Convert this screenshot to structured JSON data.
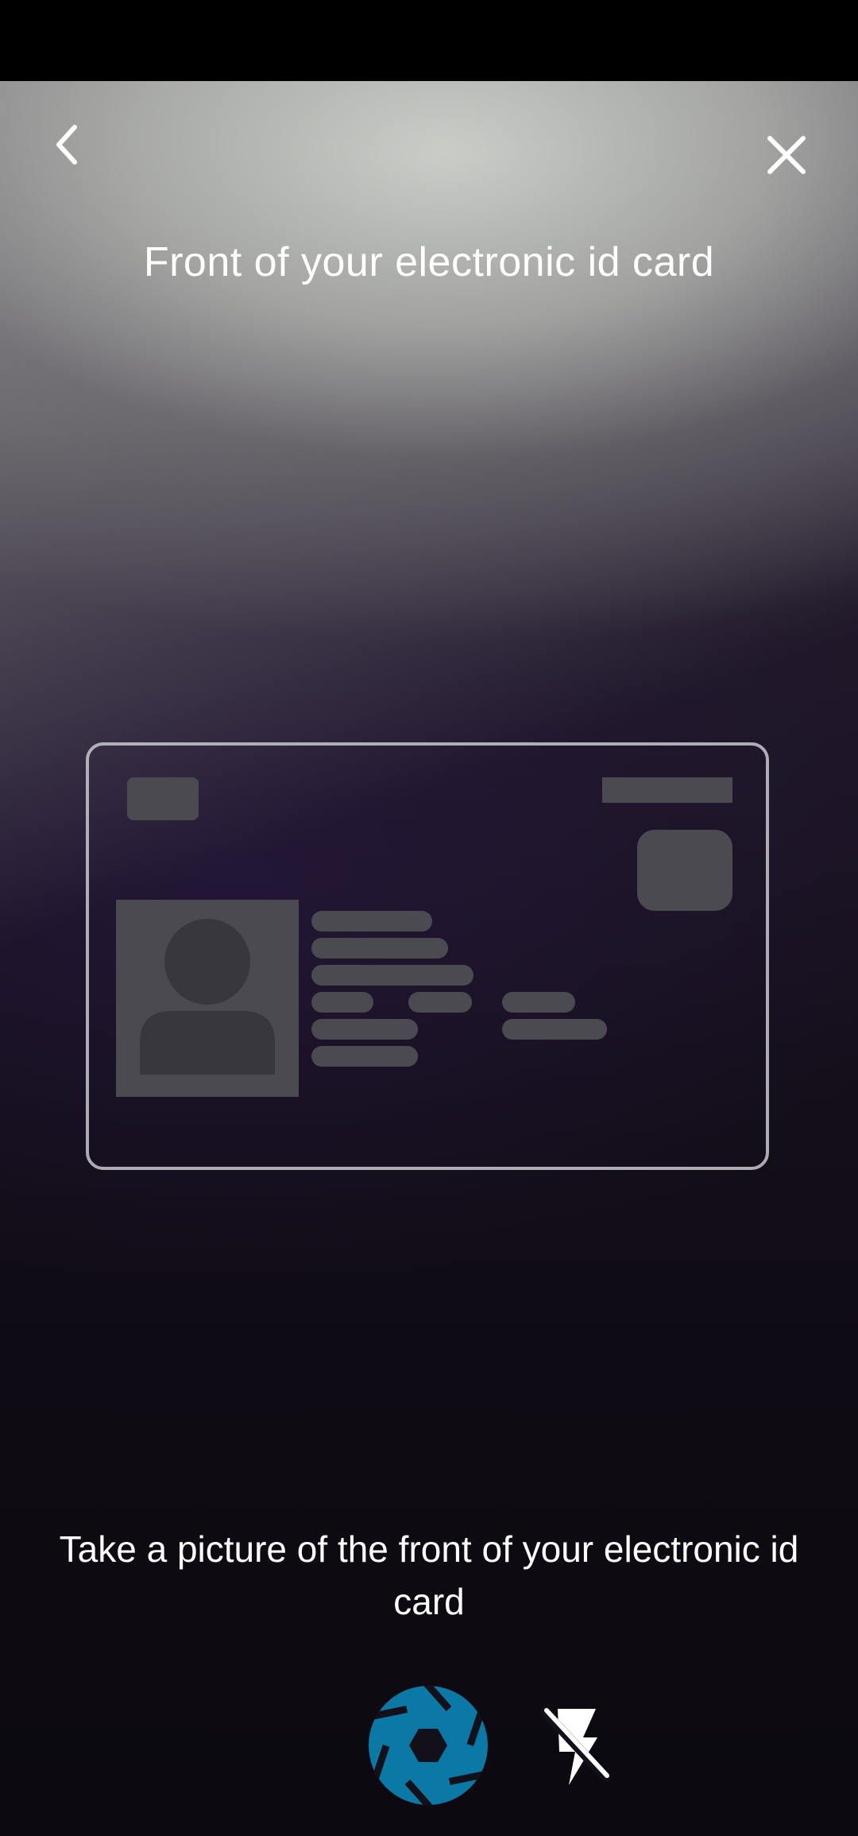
{
  "screen": {
    "title": "Front of your electronic id card",
    "instruction": "Take a picture of the front of your electronic id card"
  },
  "controls": {
    "back_icon": "chevron-left-icon",
    "close_icon": "close-icon",
    "shutter_icon": "camera-shutter-icon",
    "flash_icon": "flash-off-icon"
  },
  "colors": {
    "shutter": "#0b79a6",
    "text": "#ffffff",
    "card_outline": "#c8c8ce",
    "placeholder": "#4b4a51"
  }
}
